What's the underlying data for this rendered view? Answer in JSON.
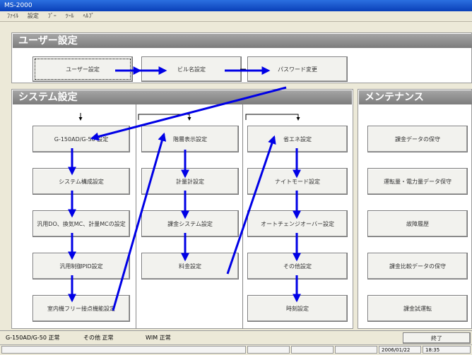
{
  "window_title": "MS-2000",
  "menu": [
    "ﾌｧｲﾙ",
    "設定",
    "ﾌﾞｰ",
    "ﾂｰﾙ",
    "ﾍﾙﾌﾟ"
  ],
  "user_section": {
    "header": "ユーザー設定",
    "buttons": [
      "ユーザー設定",
      "ビル名設定",
      "パスワード変更"
    ]
  },
  "system_section": {
    "header": "システム設定",
    "col1": [
      "G-150AD/G-50 設定",
      "システム構成設定",
      "汎用DO、換気MC、計量MCの設定",
      "汎用制御PID設定",
      "室内機フリー接点機能設定"
    ],
    "col2": [
      "階層表示設定",
      "計量計設定",
      "課金システム設定",
      "料金設定"
    ],
    "col3": [
      "省エネ設定",
      "ナイトモード設定",
      "オートチェンジオーバー設定",
      "その他設定",
      "時刻設定"
    ]
  },
  "maint_section": {
    "header": "メンテナンス",
    "buttons": [
      "課金データの保守",
      "運転量・電力量データ保守",
      "故障履歴",
      "課金比較データの保守",
      "課金試運転"
    ]
  },
  "status": {
    "g150": "G-150AD/G-50  正常",
    "other": "その他  正常",
    "wim": "WIM  正常",
    "exit_label": "終了"
  },
  "bottom": {
    "date": "2006/01/22",
    "time": "18:35"
  },
  "colors": {
    "arrow": "#0000e6",
    "header_bg": "#8c8c8c"
  }
}
